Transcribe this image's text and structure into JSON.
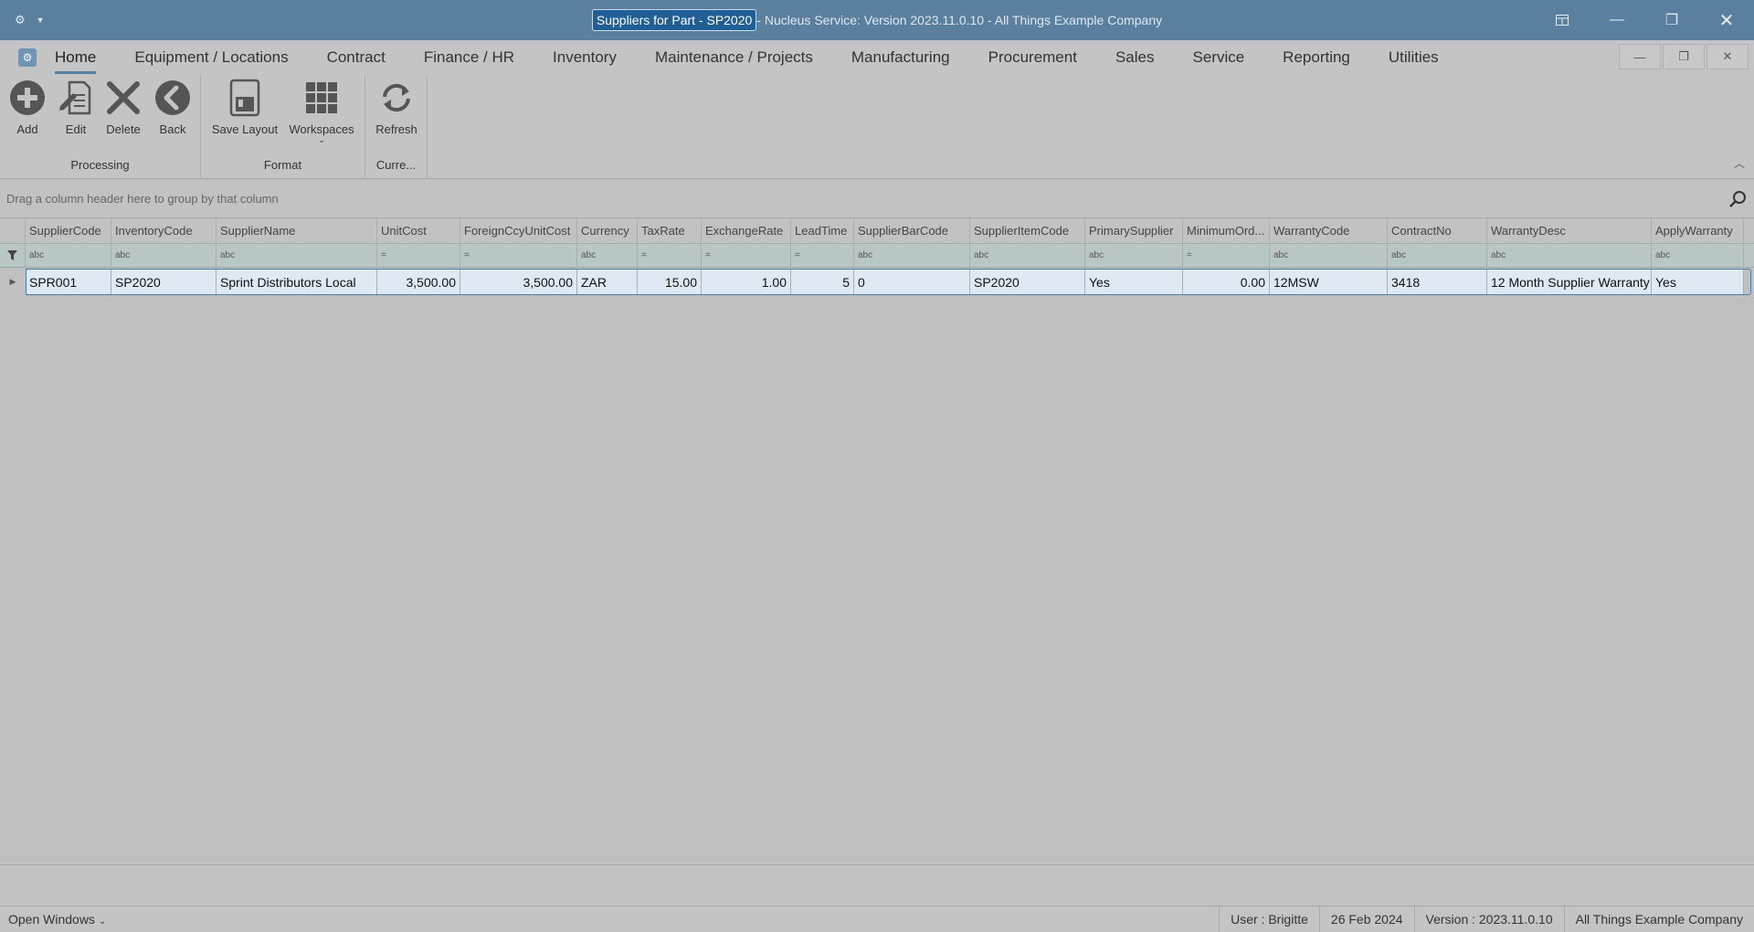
{
  "titlebar": {
    "highlight": "Suppliers for Part - SP2020",
    "rest": " - Nucleus Service: Version 2023.11.0.10 - All Things Example Company"
  },
  "menu": {
    "items": [
      "Home",
      "Equipment / Locations",
      "Contract",
      "Finance / HR",
      "Inventory",
      "Maintenance / Projects",
      "Manufacturing",
      "Procurement",
      "Sales",
      "Service",
      "Reporting",
      "Utilities"
    ]
  },
  "ribbon": {
    "processing": {
      "label": "Processing",
      "add": "Add",
      "edit": "Edit",
      "delete": "Delete",
      "back": "Back"
    },
    "format": {
      "label": "Format",
      "save_layout": "Save Layout",
      "workspaces": "Workspaces"
    },
    "current": {
      "label": "Curre...",
      "refresh": "Refresh"
    }
  },
  "grouppanel": {
    "hint": "Drag a column header here to group by that column"
  },
  "grid": {
    "columns": [
      "SupplierCode",
      "InventoryCode",
      "SupplierName",
      "UnitCost",
      "ForeignCcyUnitCost",
      "Currency",
      "TaxRate",
      "ExchangeRate",
      "LeadTime",
      "SupplierBarCode",
      "SupplierItemCode",
      "PrimarySupplier",
      "MinimumOrd...",
      "WarrantyCode",
      "ContractNo",
      "WarrantyDesc",
      "ApplyWarranty"
    ],
    "filter_glyphs": [
      "abc",
      "abc",
      "abc",
      "=",
      "=",
      "abc",
      "=",
      "=",
      "=",
      "abc",
      "abc",
      "abc",
      "=",
      "abc",
      "abc",
      "abc",
      "abc"
    ],
    "rows": [
      [
        "SPR001",
        "SP2020",
        "Sprint Distributors Local",
        "3,500.00",
        "3,500.00",
        "ZAR",
        "15.00",
        "1.00",
        "5",
        "0",
        "SP2020",
        "Yes",
        "0.00",
        "12MSW",
        "3418",
        "12 Month Supplier Warranty",
        "Yes"
      ]
    ]
  },
  "statusbar": {
    "open_windows": "Open Windows",
    "user": "User : Brigitte",
    "date": "26 Feb 2024",
    "version": "Version : 2023.11.0.10",
    "company": "All Things Example Company"
  }
}
